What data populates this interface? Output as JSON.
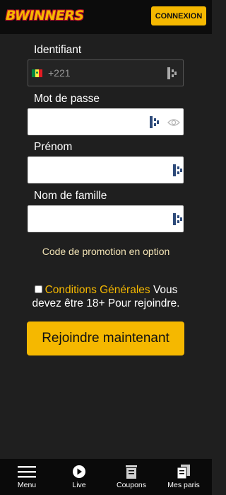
{
  "header": {
    "logo_text": "BWINNERS",
    "login_label": "CONNEXION",
    "colors": {
      "accent": "#f5b800",
      "logo_outline": "#c0122a"
    }
  },
  "form": {
    "identifiant": {
      "label": "Identifiant",
      "prefix": "+221",
      "value": ""
    },
    "password": {
      "label": "Mot de passe",
      "value": ""
    },
    "firstname": {
      "label": "Prénom",
      "value": ""
    },
    "lastname": {
      "label": "Nom de famille",
      "value": ""
    },
    "promo_label": "Code de promotion en option",
    "terms": {
      "checked": false,
      "link_text": "Conditions Générales",
      "rest_text": " Vous devez être 18+ Pour rejoindre."
    },
    "submit_label": "Rejoindre maintenant"
  },
  "bottom_nav": {
    "items": [
      {
        "label": "Menu",
        "icon": "hamburger-icon"
      },
      {
        "label": "Live",
        "icon": "play-icon"
      },
      {
        "label": "Coupons",
        "icon": "coupon-icon"
      },
      {
        "label": "Mes paris",
        "icon": "bets-icon"
      }
    ]
  },
  "colors": {
    "background": "#1f1f1f",
    "header": "#0c0c0c",
    "accent": "#f5b800"
  }
}
